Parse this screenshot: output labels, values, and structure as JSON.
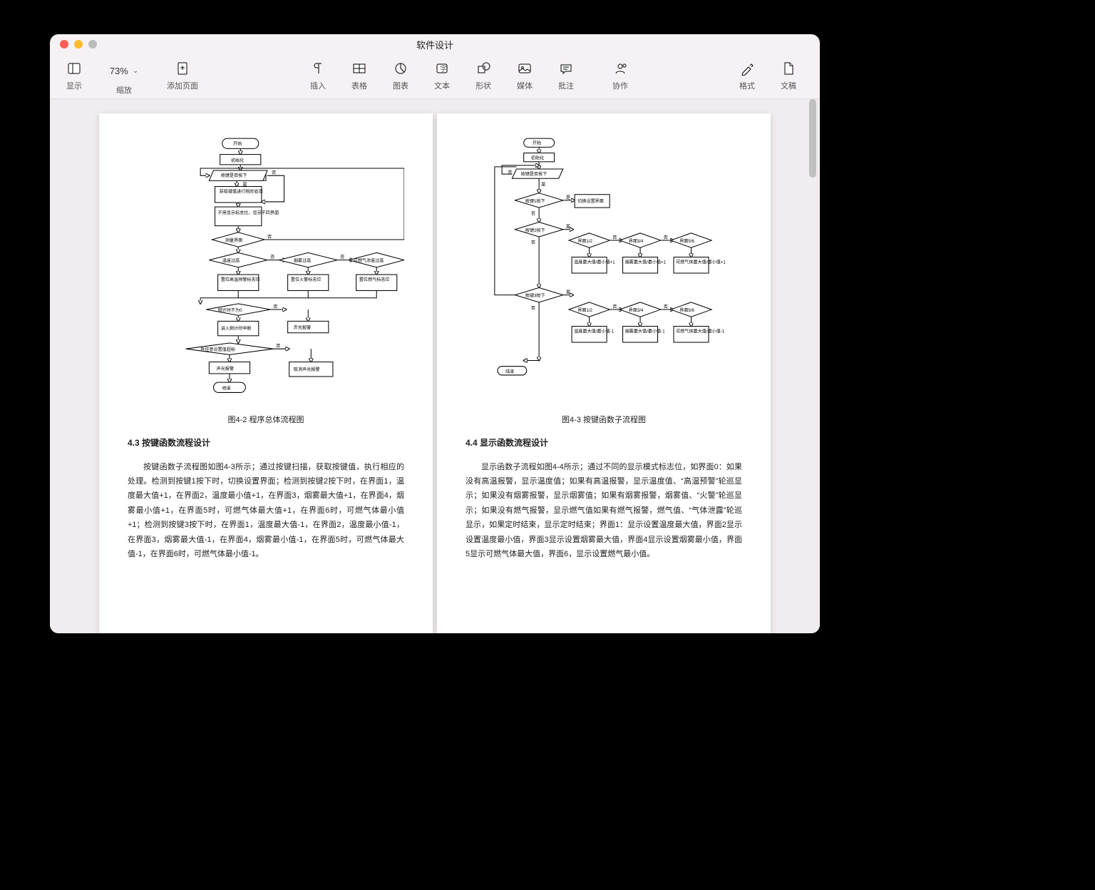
{
  "window": {
    "title": "软件设计"
  },
  "toolbar": {
    "view_label": "显示",
    "zoom_label": "缩放",
    "zoom_value": "73%",
    "addpage_label": "添加页面",
    "insert_label": "插入",
    "table_label": "表格",
    "chart_label": "图表",
    "text_label": "文本",
    "shape_label": "形状",
    "media_label": "媒体",
    "comment_label": "批注",
    "collab_label": "协作",
    "format_label": "格式",
    "document_label": "文稿"
  },
  "page_left": {
    "figure_caption": "图4-2  程序总体流程图",
    "section_heading": "4.3 按键函数流程设计",
    "body": "按键函数子流程图如图4-3所示；通过按键扫描，获取按键值，执行相应的处理。检测到按键1按下时，切换设置界面；检测到按键2按下时，在界面1，温度最大值+1，在界面2，温度最小值+1，在界面3，烟雾最大值+1，在界面4，烟雾最小值+1，在界面5时，可燃气体最大值+1，在界面6时，可燃气体最小值+1；检测到按键3按下时，在界面1，温度最大值-1，在界面2，温度最小值-1，在界面3，烟雾最大值-1，在界面4，烟雾最小值-1，在界面5时，可燃气体最大值-1，在界面6时，可燃气体最小值-1。",
    "flow": {
      "start": "开始",
      "init": "初始化",
      "key_pressed": "按键是否按下",
      "get_key": "获取键值进行相应处理",
      "display_flag": "不用显示标志位，显示不同界面",
      "measure": "测量界面",
      "temp_high": "温度过高",
      "smoke_high": "烟雾过高",
      "gas_high": "可燃气浓度过高",
      "set_temp_flag": "置位高温预警标志位",
      "set_fire_flag": "置位火警标志位",
      "set_gas_flag": "置位燃气标志位",
      "timer_not0": "倒计时不为0",
      "enter_timer": "进入倒计时中断",
      "sound_alarm": "声光报警",
      "any_set_flag": "有任意设置值超标",
      "sound_alarm2": "声光报警",
      "cancel_alarm": "取消声光报警",
      "end": "结束",
      "yes": "是",
      "no": "否"
    }
  },
  "page_right": {
    "figure_caption": "图4-3  按键函数子流程图",
    "section_heading": "4.4 显示函数流程设计",
    "body": "显示函数子流程如图4-4所示；通过不同的显示模式标志位，如界面0：如果没有高温报警，显示温度值；如果有高温报警，显示温度值、“高温预警”轮巡显示；如果没有烟雾报警，显示烟雾值；如果有烟雾报警，烟雾值、“火警”轮巡显示；如果没有燃气报警，显示燃气值如果有燃气报警，燃气值、“气体泄露”轮巡显示，如果定时结束，显示定时结束；界面1：显示设置温度最大值，界面2显示设置温度最小值，界面3显示设置烟雾最大值，界面4显示设置烟雾最小值，界面5显示可燃气体最大值，界面6，显示设置燃气最小值。",
    "flow": {
      "start": "开始",
      "init": "初始化",
      "key_pressed": "按键是否按下",
      "key1": "按键1按下",
      "switch_screen": "切换设置界面",
      "key2": "按键2按下",
      "screen12": "界面1/2",
      "screen34": "界面3/4",
      "screen56": "界面5/6",
      "temp_pm": "温度最大值/最小值+1",
      "smoke_pm": "烟雾最大值/最小值+1",
      "gas_pm": "可燃气体最大值/最小值+1",
      "key3": "按键3按下",
      "screen12b": "界面1/2",
      "screen34b": "界面3/4",
      "screen56b": "界面5/6",
      "temp_mm": "温度最大值/最小值-1",
      "smoke_mm": "烟雾最大值/最小值-1",
      "gas_mm": "可燃气体最大值/最小值-1",
      "end": "结束",
      "yes": "是",
      "no": "否"
    }
  }
}
